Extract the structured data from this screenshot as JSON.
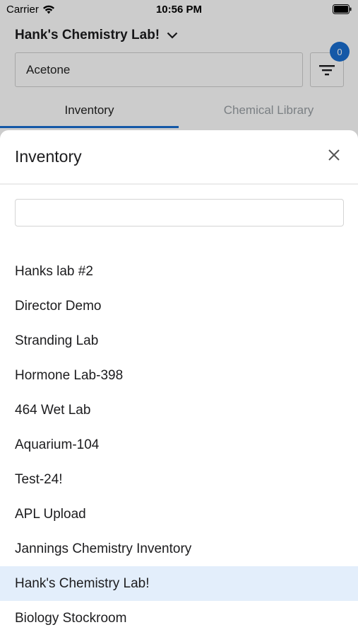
{
  "status_bar": {
    "carrier": "Carrier",
    "time": "10:56 PM"
  },
  "header": {
    "lab_name": "Hank's Chemistry Lab!"
  },
  "search": {
    "value": "Acetone"
  },
  "filter": {
    "badge_count": "0"
  },
  "tabs": [
    {
      "label": "Inventory",
      "active": true
    },
    {
      "label": "Chemical Library",
      "active": false
    }
  ],
  "sheet": {
    "title": "Inventory",
    "search_value": "",
    "items": [
      {
        "label": "Hanks lab #2"
      },
      {
        "label": "Director Demo"
      },
      {
        "label": "Stranding Lab"
      },
      {
        "label": "Hormone Lab-398"
      },
      {
        "label": "464 Wet Lab"
      },
      {
        "label": "Aquarium-104"
      },
      {
        "label": "Test-24!"
      },
      {
        "label": "APL Upload"
      },
      {
        "label": "Jannings Chemistry Inventory"
      },
      {
        "label": "Hank's Chemistry Lab!",
        "selected": true
      },
      {
        "label": "Biology Stockroom"
      }
    ]
  },
  "colors": {
    "accent": "#1a6fd1",
    "selected_row": "#e3eefb"
  },
  "icons": {
    "wifi": "wifi-icon",
    "battery": "battery-icon",
    "dropdown": "chevron-down-icon",
    "filter": "filter-icon",
    "close": "close-icon"
  }
}
